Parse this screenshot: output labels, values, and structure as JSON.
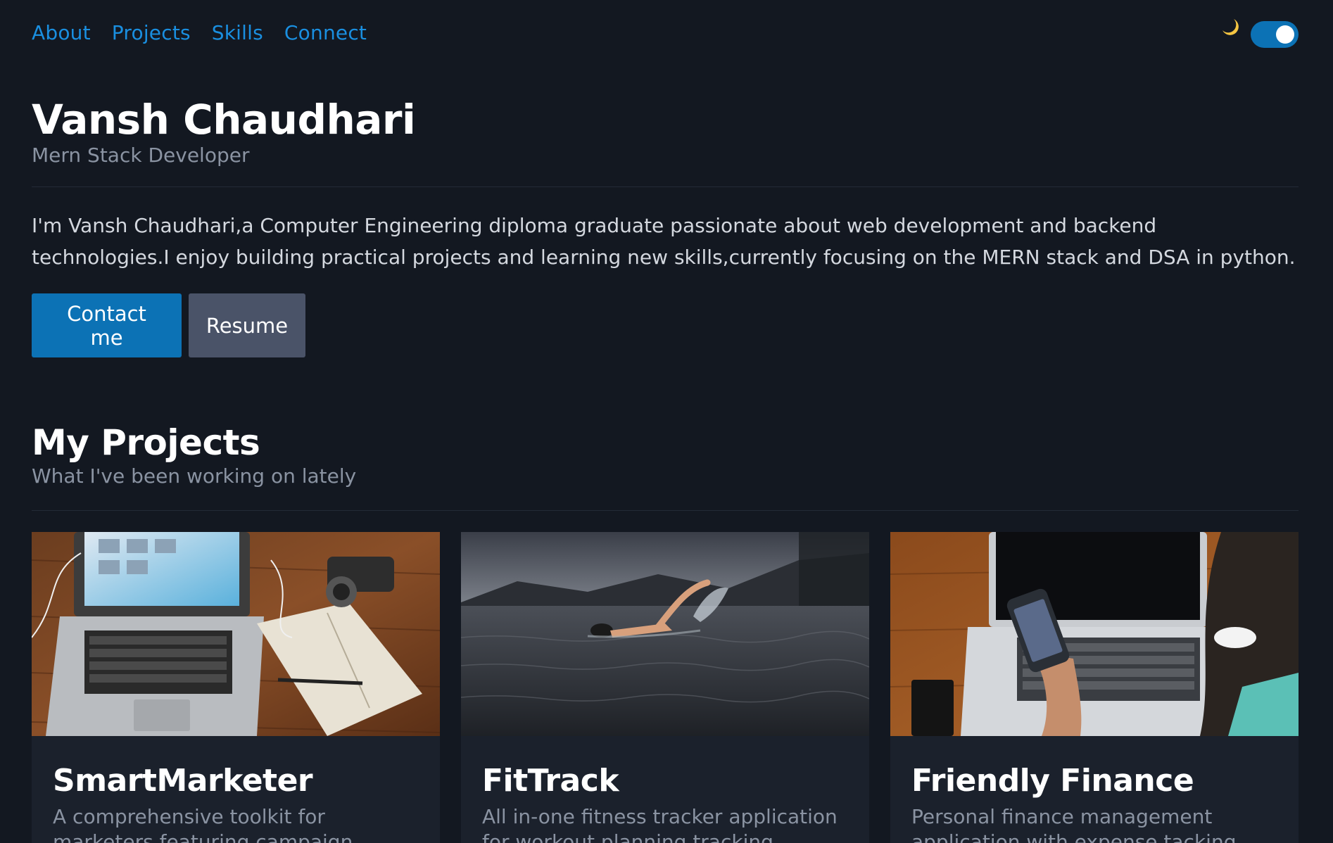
{
  "nav": {
    "items": [
      {
        "label": "About"
      },
      {
        "label": "Projects"
      },
      {
        "label": "Skills"
      },
      {
        "label": "Connect"
      }
    ],
    "theme_icon": "moon-icon",
    "theme_toggle_on": true
  },
  "hero": {
    "name": "Vansh Chaudhari",
    "role": "Mern Stack Developer",
    "bio": "I'm Vansh Chaudhari,a Computer Engineering diploma graduate passionate about web development and backend technologies.I enjoy building practical projects and learning new skills,currently focusing on the MERN stack and DSA in python.",
    "contact_label": "Contact me",
    "resume_label": "Resume"
  },
  "projects": {
    "title": "My Projects",
    "subtitle": "What I've been working on lately",
    "items": [
      {
        "title": "SmartMarketer",
        "description": "A comprehensive toolkit for marketers featuring campaign tracking, social",
        "image": "laptop-desk-photo"
      },
      {
        "title": "FitTrack",
        "description": "All in-one fitness tracker application for workout planning tracking",
        "image": "swimmer-lake-photo"
      },
      {
        "title": "Friendly Finance",
        "description": "Personal finance management application with expense tacking",
        "image": "phone-laptop-photo"
      }
    ]
  },
  "colors": {
    "background": "#131821",
    "accent": "#1a8fe0",
    "primary_button": "#0c72b5",
    "secondary_button": "#4a5368",
    "muted_text": "#8a93a2"
  }
}
